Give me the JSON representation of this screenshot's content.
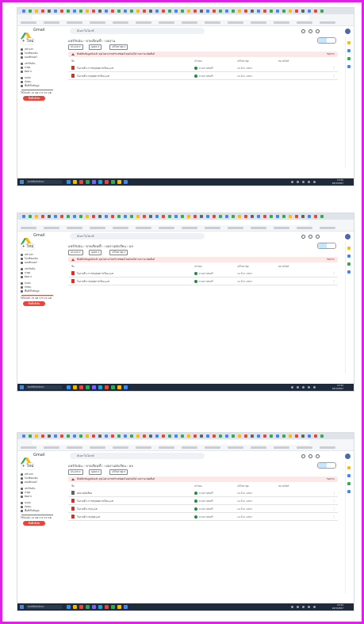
{
  "colors": {
    "frame": "#e020e6",
    "warning_bg": "#fce8e6",
    "warning_icon": "#d93025",
    "upgrade_button": "#e8453c",
    "pdf_icon": "#d93025",
    "folder_icon": "#5f6368",
    "selected_view": "#c2e7ff",
    "taskbar": "#1f2b3a"
  },
  "shots": [
    {
      "app_name": "Gmail",
      "search_placeholder": "ค้นหาในไดรฟ์",
      "new_label": "+ ใหม่",
      "nav": [
        "หน้าแรก",
        "ไดรฟ์ของฉัน",
        "คอมพิวเตอร์",
        "แชร์กับฉัน",
        "ล่าสุด",
        "ติดดาว",
        "สแปม",
        "ถังขยะ",
        "พื้นที่เก็บข้อมูล"
      ],
      "storage_text": "ใช้ไปแล้ว 15 GB จาก 15 GB",
      "upgrade_label": "ซื้อพื้นที่เพิ่ม",
      "breadcrumb": [
        "แชร์กับฉัน",
        "ขาดเรียนซ้ำ",
        "ผลงาน"
      ],
      "chips": [
        "ประเภท ▾",
        "บุคคล ▾",
        "แก้ไขล่าสุด ▾"
      ],
      "warning_text": "พื้นที่เก็บข้อมูลเต็มแล้ว คุณไม่สามารถสร้างหรืออัปโหลดไฟล์ได้ จนกว่าจะเพิ่มพื้นที่",
      "warning_action": "รับทราบ",
      "headers": [
        "ชื่อ",
        "เจ้าของ",
        "แก้ไขล่าสุด",
        "ขนาดไฟล์"
      ],
      "files": [
        {
          "name": "ใบงานที่ 1 การสรุปผลการเรียน.pdf",
          "type": "pdf",
          "owner": "นางสาวสมศรี",
          "modified": "14 มี.ค. 2567"
        },
        {
          "name": "ใบงานที่ 2 สรุปผลการเรียน.pdf",
          "type": "pdf",
          "owner": "นางสาวสมศรี",
          "modified": "14 มี.ค. 2567"
        }
      ]
    },
    {
      "app_name": "Gmail",
      "search_placeholder": "ค้นหาในไดรฟ์",
      "new_label": "+ ใหม่",
      "nav": [
        "หน้าแรก",
        "ไดรฟ์ของฉัน",
        "คอมพิวเตอร์",
        "แชร์กับฉัน",
        "ล่าสุด",
        "ติดดาว",
        "สแปม",
        "ถังขยะ",
        "พื้นที่เก็บข้อมูล"
      ],
      "storage_text": "ใช้ไปแล้ว 15 GB จาก 15 GB",
      "upgrade_label": "ซื้อพื้นที่เพิ่ม",
      "breadcrumb": [
        "แชร์กับฉัน",
        "ขาดเรียนซ้ำ",
        "ผลงานนักเรียน",
        "ผล"
      ],
      "chips": [
        "ประเภท ▾",
        "บุคคล ▾",
        "แก้ไขล่าสุด ▾"
      ],
      "warning_text": "พื้นที่เก็บข้อมูลเต็มแล้ว คุณไม่สามารถสร้างหรืออัปโหลดไฟล์ได้ จนกว่าจะเพิ่มพื้นที่",
      "warning_action": "รับทราบ",
      "headers": [
        "ชื่อ",
        "เจ้าของ",
        "แก้ไขล่าสุด",
        "ขนาดไฟล์"
      ],
      "files": [
        {
          "name": "ใบงานที่ 1 การสรุปผลการเรียน.pdf",
          "type": "pdf",
          "owner": "นางสาวสมศรี",
          "modified": "14 มี.ค. 2567"
        },
        {
          "name": "ใบงานที่ 2 สรุปผลการเรียน.pdf",
          "type": "pdf",
          "owner": "นางสาวสมศรี",
          "modified": "14 มี.ค. 2567"
        }
      ]
    },
    {
      "app_name": "Gmail",
      "search_placeholder": "ค้นหาในไดรฟ์",
      "new_label": "+ ใหม่",
      "nav": [
        "หน้าแรก",
        "ไดรฟ์ของฉัน",
        "คอมพิวเตอร์",
        "แชร์กับฉัน",
        "ล่าสุด",
        "ติดดาว",
        "สแปม",
        "ถังขยะ",
        "พื้นที่เก็บข้อมูล"
      ],
      "storage_text": "ใช้ไปแล้ว 15 GB จาก 15 GB",
      "upgrade_label": "ซื้อพื้นที่เพิ่ม",
      "breadcrumb": [
        "แชร์กับฉัน",
        "ขาดเรียนซ้ำ",
        "ผลงานนักเรียน",
        "ผล"
      ],
      "chips": [
        "ประเภท ▾",
        "บุคคล ▾",
        "แก้ไขล่าสุด ▾"
      ],
      "warning_text": "พื้นที่เก็บข้อมูลเต็มแล้ว คุณไม่สามารถสร้างหรืออัปโหลดไฟล์ได้ จนกว่าจะเพิ่มพื้นที่",
      "warning_action": "รับทราบ",
      "headers": [
        "ชื่อ",
        "เจ้าของ",
        "แก้ไขล่าสุด",
        "ขนาดไฟล์"
      ],
      "files": [
        {
          "name": "ผลงานนักเรียน",
          "type": "folder",
          "owner": "นางสาวสมศรี",
          "modified": "14 มี.ค. 2567"
        },
        {
          "name": "ใบงานที่ 1 การสรุปผลการเรียน.pdf",
          "type": "pdf",
          "owner": "นางสาวสมศรี",
          "modified": "14 มี.ค. 2567"
        },
        {
          "name": "ใบงานที่ 2 สรุป.pdf",
          "type": "pdf",
          "owner": "นางสาวสมศรี",
          "modified": "14 มี.ค. 2567"
        },
        {
          "name": "ใบงานที่ 3 สรุปผล.pdf",
          "type": "pdf",
          "owner": "นางสาวสมศรี",
          "modified": "14 มี.ค. 2567"
        }
      ]
    }
  ],
  "taskbar": {
    "search_placeholder": "พิมพ์ที่นี่เพื่อค้นหา",
    "clock_time": "13:52",
    "clock_date": "18/3/2567"
  }
}
